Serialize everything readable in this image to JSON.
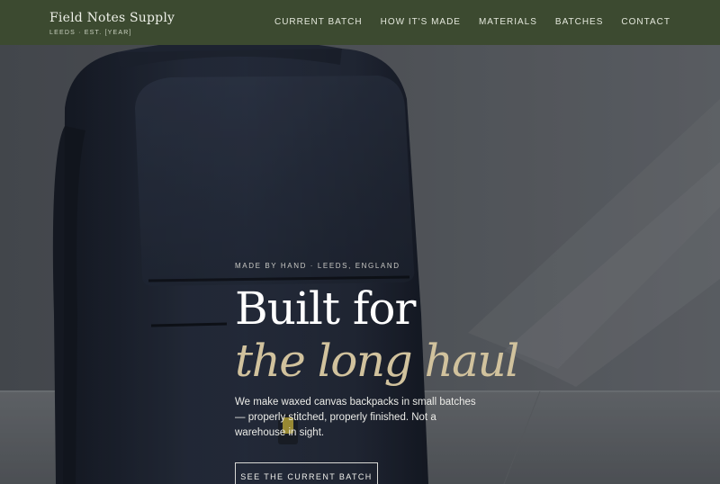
{
  "header": {
    "brand_name": "Field Notes Supply",
    "brand_tagline": "LEEDS · EST. [YEAR]",
    "nav": [
      {
        "label": "CURRENT BATCH"
      },
      {
        "label": "HOW IT'S MADE"
      },
      {
        "label": "MATERIALS"
      },
      {
        "label": "BATCHES"
      },
      {
        "label": "CONTACT"
      }
    ]
  },
  "hero": {
    "eyebrow": "MADE BY HAND · LEEDS, ENGLAND",
    "headline_line1": "Built for",
    "headline_line2": "the long haul",
    "body": "We make waxed canvas backpacks in small batches — properly stitched, properly finished. Not a warehouse in sight.",
    "cta_label": "SEE THE CURRENT BATCH",
    "image_subject": "backpack-photo"
  },
  "colors": {
    "header_bg": "#3c4a30",
    "accent_gold": "#d1c29d",
    "text_light": "#ecece8"
  }
}
